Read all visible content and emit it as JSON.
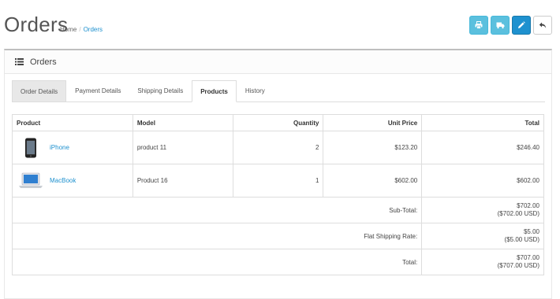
{
  "header": {
    "title": "Orders",
    "breadcrumb": {
      "home": "Home",
      "separator": "/",
      "current": "Orders"
    }
  },
  "toolbar": {
    "buttons": [
      {
        "icon": "print-icon",
        "color": "#5bc0de"
      },
      {
        "icon": "truck-icon",
        "color": "#5bc0de"
      },
      {
        "icon": "pencil-icon",
        "color": "#1e91cf"
      },
      {
        "icon": "reply-icon",
        "color": "#ffffff"
      }
    ]
  },
  "panel": {
    "heading_icon": "list-icon",
    "heading": "Orders"
  },
  "tabs": [
    {
      "label": "Order Details",
      "state": "grey"
    },
    {
      "label": "Payment Details",
      "state": "normal"
    },
    {
      "label": "Shipping Details",
      "state": "normal"
    },
    {
      "label": "Products",
      "state": "active"
    },
    {
      "label": "History",
      "state": "normal"
    }
  ],
  "table": {
    "columns": [
      "Product",
      "Model",
      "Quantity",
      "Unit Price",
      "Total"
    ],
    "rows": [
      {
        "product": "iPhone",
        "thumb": "iphone-thumbnail",
        "model": "product 11",
        "quantity": "2",
        "unit_price": "$123.20",
        "total": "$246.40"
      },
      {
        "product": "MacBook",
        "thumb": "macbook-thumbnail",
        "model": "Product 16",
        "quantity": "1",
        "unit_price": "$602.00",
        "total": "$602.00"
      }
    ],
    "totals": [
      {
        "label": "Sub-Total:",
        "value": "$702.00",
        "value_usd": "($702.00 USD)"
      },
      {
        "label": "Flat Shipping Rate:",
        "value": "$5.00",
        "value_usd": "($5.00 USD)"
      },
      {
        "label": "Total:",
        "value": "$707.00",
        "value_usd": "($707.00 USD)"
      }
    ]
  },
  "colors": {
    "link": "#1e91cf",
    "info_button": "#5bc0de",
    "primary_button": "#1e91cf"
  }
}
